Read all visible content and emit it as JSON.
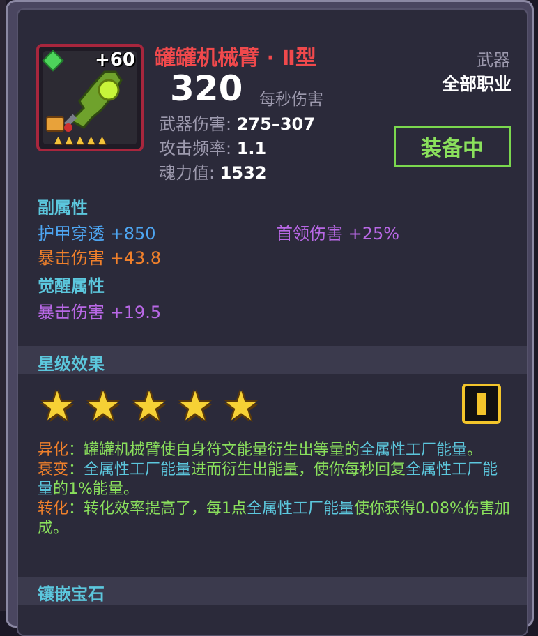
{
  "item": {
    "name": "罐罐机械臂 · Ⅱ型",
    "level_bonus": "+60",
    "dps_value": "320",
    "dps_label": "每秒伤害",
    "type": "武器",
    "class": "全部职业",
    "stats": [
      {
        "label": "武器伤害: ",
        "value": "275–307"
      },
      {
        "label": "攻击频率: ",
        "value": "1.1"
      },
      {
        "label": "魂力值: ",
        "value": "1532"
      }
    ],
    "equip_button": "装备中"
  },
  "sub_attrs": {
    "title": "副属性",
    "armor_pen": {
      "label": "护甲穿透 ",
      "value": "+850"
    },
    "boss_dmg": {
      "label": "首领伤害 ",
      "value": "+25%"
    },
    "crit_dmg": {
      "label": "暴击伤害 ",
      "value": "+43.8"
    }
  },
  "awaken": {
    "title": "觉醒属性",
    "crit_dmg": {
      "label": "暴击伤害 ",
      "value": "+19.5"
    }
  },
  "star_effects": {
    "title": "星级效果",
    "star_count": 5,
    "lines": [
      {
        "label": "异化",
        "text_a": "：罐罐机械臂使自身符文能量衍生出等量的",
        "text_b": "全属性工厂能量",
        "text_c": "。"
      },
      {
        "label": "衰变",
        "text_a": "：",
        "text_b": "全属性工厂能量",
        "text_c": "进而衍生出能量，使你每秒回复",
        "text_d": "全属性工厂能量",
        "text_e": "的1%能量。"
      },
      {
        "label": "转化",
        "text_a": "：转化效率提高了，每1点",
        "text_b": "全属性工厂能量",
        "text_c": "使你获得0.08%伤害加成。"
      }
    ]
  },
  "gems": {
    "title": "镶嵌宝石"
  },
  "colors": {
    "title": "#f0494c",
    "section": "#5cc7dd",
    "equip": "#8ae05c",
    "border": "#a8263d"
  }
}
